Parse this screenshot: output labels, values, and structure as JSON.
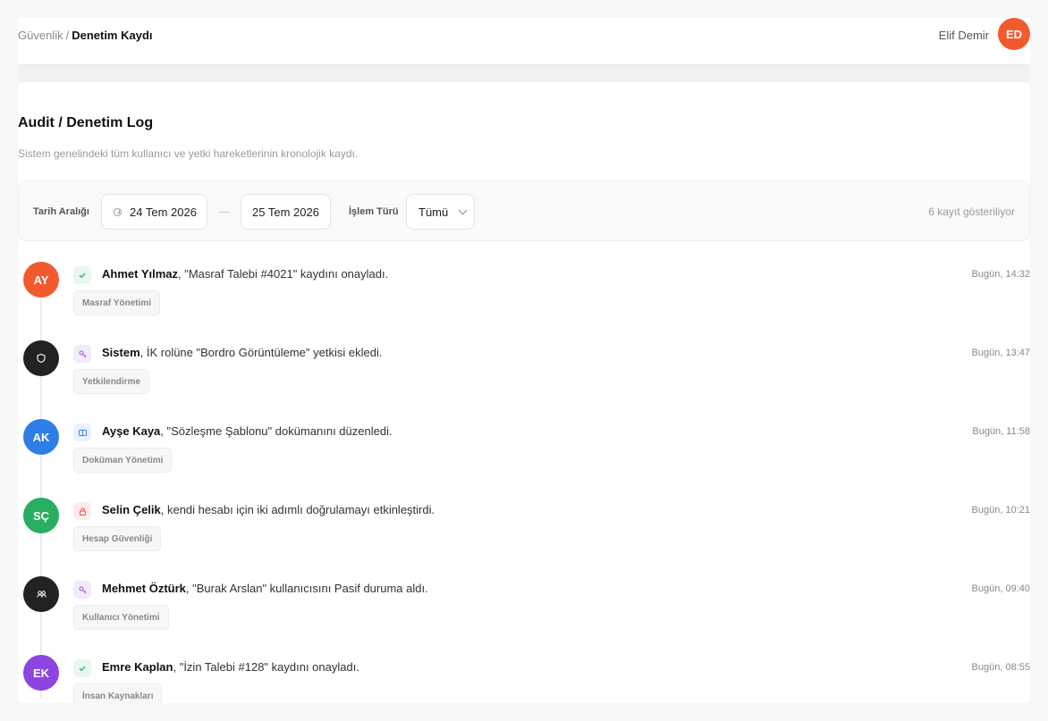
{
  "header": {
    "breadcrumb_parent": "Güvenlik",
    "breadcrumb_sep": "/",
    "breadcrumb_current": "Denetim Kaydı",
    "user_name": "Elif Demir",
    "user_initials": "ED"
  },
  "page": {
    "title": "Audit / Denetim Log",
    "subtitle": "Sistem genelindeki tüm kullanıcı ve yetki hareketlerinin kronolojik kaydı."
  },
  "filters": {
    "date_label": "Tarih Aralığı",
    "date_from": "24 Tem 2026",
    "date_to": "25 Tem 2026",
    "type_label": "İşlem Türü",
    "type_value": "Tümü",
    "count_text": "6 kayıt gösteriliyor"
  },
  "entries": [
    {
      "initials": "AY",
      "avatar_color": "#f25a2e",
      "icon": "check-icon",
      "icon_bg": "#e9f8ef",
      "icon_color": "#22a45d",
      "actor": "Ahmet Yılmaz",
      "text": ", \"Masraf Talebi #4021\" kaydını onayladı.",
      "time": "Bugün, 14:32",
      "tag": "Masraf Yönetimi"
    },
    {
      "initials": "",
      "avatar_color": "#222222",
      "avatar_icon": "shield-icon",
      "icon": "key-icon",
      "icon_bg": "#f3ebfc",
      "icon_color": "#9b59d0",
      "actor": "Sistem",
      "text": ", İK rolüne \"Bordro Görüntüleme\" yetkisi ekledi.",
      "time": "Bugün, 13:47",
      "tag": "Yetkilendirme"
    },
    {
      "initials": "AK",
      "avatar_color": "#2f7ee8",
      "icon": "document-icon",
      "icon_bg": "#eaf2fd",
      "icon_color": "#3b82f6",
      "actor": "Ayşe Kaya",
      "text": ", \"Sözleşme Şablonu\" dokümanını düzenledi.",
      "time": "Bugün, 11:58",
      "tag": "Doküman Yönetimi"
    },
    {
      "initials": "SÇ",
      "avatar_color": "#27ae60",
      "icon": "lock-icon",
      "icon_bg": "#fdecec",
      "icon_color": "#e25555",
      "actor": "Selin Çelik",
      "text": ", kendi hesabı için iki adımlı doğrulamayı etkinleştirdi.",
      "time": "Bugün, 10:21",
      "tag": "Hesap Güvenliği"
    },
    {
      "initials": "",
      "avatar_color": "#222222",
      "avatar_icon": "users-icon",
      "icon": "key-icon",
      "icon_bg": "#f3ebfc",
      "icon_color": "#9b59d0",
      "actor": "Mehmet Öztürk",
      "text": ", \"Burak Arslan\" kullanıcısını Pasif duruma aldı.",
      "time": "Bugün, 09:40",
      "tag": "Kullanıcı Yönetimi"
    },
    {
      "initials": "EK",
      "avatar_color": "#8e44e0",
      "icon": "check-icon",
      "icon_bg": "#e9f8ef",
      "icon_color": "#22a45d",
      "actor": "Emre Kaplan",
      "text": ", \"İzin Talebi #128\" kaydını onayladı.",
      "time": "Bugün, 08:55",
      "tag": "İnsan Kaynakları"
    }
  ]
}
